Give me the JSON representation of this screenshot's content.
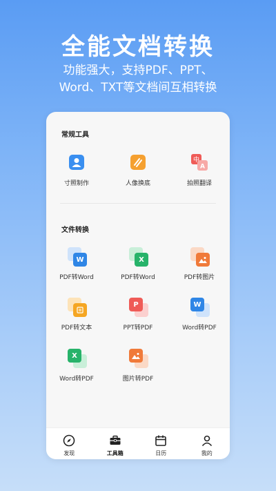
{
  "promo": {
    "headline": "全能文档转换",
    "subline1": "功能强大，支持PDF、PPT、",
    "subline2": "Word、TXT等文档间互相转换"
  },
  "sections": {
    "common": {
      "title": "常规工具",
      "items": [
        {
          "label": "寸照制作",
          "icon": "id-photo-icon"
        },
        {
          "label": "人像换底",
          "icon": "portrait-background-icon"
        },
        {
          "label": "拍照翻译",
          "icon": "photo-translate-icon"
        }
      ]
    },
    "convert": {
      "title": "文件转换",
      "items": [
        {
          "label": "PDF转Word",
          "icon": "pdf-to-word-icon"
        },
        {
          "label": "PDF转Word",
          "icon": "pdf-to-excel-icon"
        },
        {
          "label": "PDF转图片",
          "icon": "pdf-to-image-icon"
        },
        {
          "label": "PDF转文本",
          "icon": "pdf-to-text-icon"
        },
        {
          "label": "PPT转PDF",
          "icon": "ppt-to-pdf-icon"
        },
        {
          "label": "Word转PDF",
          "icon": "word-to-pdf-icon"
        },
        {
          "label": "Word转PDF",
          "icon": "excel-to-pdf-icon"
        },
        {
          "label": "图片转PDF",
          "icon": "image-to-pdf-icon"
        }
      ]
    }
  },
  "tabs": [
    {
      "label": "发现",
      "icon": "compass-icon",
      "active": false
    },
    {
      "label": "工具箱",
      "icon": "toolbox-icon",
      "active": true
    },
    {
      "label": "日历",
      "icon": "calendar-icon",
      "active": false
    },
    {
      "label": "我的",
      "icon": "user-icon",
      "active": false
    }
  ],
  "colors": {
    "word_blue": "#2f86e6",
    "excel_green": "#27b36a",
    "image_orange": "#f07a3a",
    "ppt_red": "#ef5b57",
    "text_orange": "#f5a623"
  }
}
